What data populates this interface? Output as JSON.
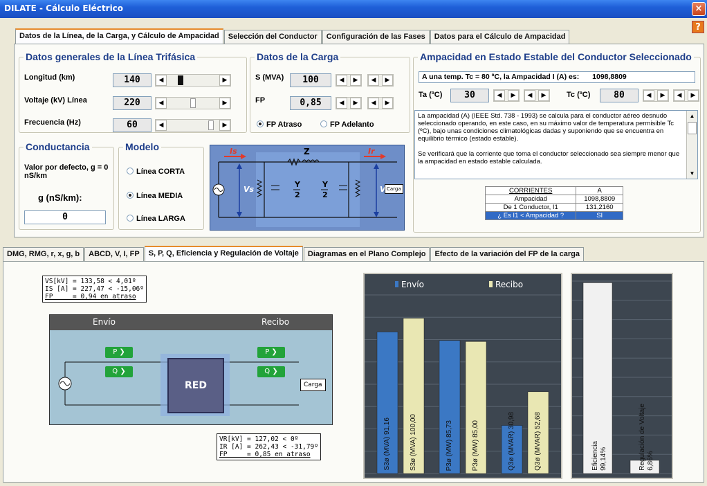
{
  "window": {
    "title": "DILATE - Cálculo Eléctrico",
    "close_glyph": "×",
    "help_glyph": "?"
  },
  "top_tabs": [
    {
      "label": "Datos de la Línea, de la Carga, y Cálculo de Ampacidad",
      "active": true
    },
    {
      "label": "Selección del Conductor",
      "active": false
    },
    {
      "label": "Configuración de las Fases",
      "active": false
    },
    {
      "label": "Datos para el Cálculo de Ampacidad",
      "active": false
    }
  ],
  "linea": {
    "title": "Datos generales de la Línea Trifásica",
    "rows": [
      {
        "label": "Longitud (km)",
        "value": "140"
      },
      {
        "label": "Voltaje (kV) Línea",
        "value": "220"
      },
      {
        "label": "Frecuencia (Hz)",
        "value": "60"
      }
    ]
  },
  "carga": {
    "title": "Datos de la Carga",
    "rows": [
      {
        "label": "S (MVA)",
        "value": "100"
      },
      {
        "label": "FP",
        "value": "0,85"
      }
    ],
    "radio_atraso": "FP Atraso",
    "radio_adelanto": "FP Adelanto",
    "selected": "atraso"
  },
  "ampacidad": {
    "title": "Ampacidad en Estado Estable del Conductor Seleccionado",
    "result_text": "A una temp. Tc = 80 ºC, la Ampacidad I (A) es:",
    "result_value": "1098,8809",
    "ta_label": "Ta (ºC)",
    "ta_value": "30",
    "tc_label": "Tc (ºC)",
    "tc_value": "80",
    "description_1": "La ampacidad (A) (IEEE Std. 738 - 1993) se calcula para el conductor aéreo desnudo seleccionado operando, en este caso, en su máximo valor de temperatura permisible Tc (ºC), bajo unas condiciones climatológicas dadas y suponiendo que se encuentra en equilibrio térmico (estado estable).",
    "description_2": "Se verificará que la corriente que toma el conductor seleccionado sea siempre menor que la ampacidad en estado estable calculada.",
    "table": {
      "headers": [
        "CORRIENTES",
        "A"
      ],
      "rows": [
        [
          "Ampacidad",
          "1098,8809"
        ],
        [
          "De 1 Conductor, I1",
          "131,2160"
        ],
        [
          "¿ Es I1 < Ampacidad ?",
          "SI"
        ]
      ]
    }
  },
  "conductancia": {
    "title": "Conductancia",
    "default_text": "Valor por defecto, g = 0 nS/km",
    "g_label": "g (nS/km):",
    "g_value": "0"
  },
  "modelo": {
    "title": "Modelo",
    "options": [
      "Línea CORTA",
      "Línea MEDIA",
      "Línea LARGA"
    ],
    "selected": 1
  },
  "circuit": {
    "is_label": "Is",
    "ir_label": "Ir",
    "z_label": "Z",
    "vs_label": "Vs",
    "vr_label": "VR",
    "y2_num": "Y",
    "y2_den": "2",
    "carga_label": "Carga"
  },
  "bottom_tabs": [
    {
      "label": "DMG, RMG, r, x, g, b",
      "active": false
    },
    {
      "label": "ABCD, V, I, FP",
      "active": false
    },
    {
      "label": "S, P, Q, Eficiencia y Regulación de Voltaje",
      "active": true
    },
    {
      "label": "Diagramas en el Plano Complejo",
      "active": false
    },
    {
      "label": "Efecto de la variación del FP de la carga",
      "active": false
    }
  ],
  "sending_readout": [
    "VS[kV] = 133,58 < 4,01º",
    "IS [A] = 227,47 < -15,06º",
    "FP     = 0,94 en atraso"
  ],
  "receiving_readout": [
    "VR[kV] = 127,02 < 0º",
    "IR [A] = 262,43 < -31,79º",
    "FP     = 0,85 en atraso"
  ],
  "flow": {
    "envio_label": "Envío",
    "recibo_label": "Recibo",
    "p_label": "P",
    "q_label": "Q",
    "red_label": "RED",
    "carga_label": "Carga"
  },
  "colors": {
    "envio_bar": "#3b78c4",
    "recibo_bar": "#e9e7b3",
    "eff_bar": "#f1f1f1",
    "chart_bg": "#3d4650"
  },
  "chart_data": [
    {
      "type": "bar",
      "legend_position": "top",
      "series": [
        {
          "name": "Envío",
          "color": "#3b78c4"
        },
        {
          "name": "Recibo",
          "color": "#e9e7b3"
        }
      ],
      "bars": [
        {
          "label": "S3ø (MVA) 91,16",
          "value": 91.16,
          "series": "Envío"
        },
        {
          "label": "S3ø (MVA) 100,00",
          "value": 100.0,
          "series": "Recibo"
        },
        {
          "label": "P3ø (MW) 85,73",
          "value": 85.73,
          "series": "Envío"
        },
        {
          "label": "P3ø (MW) 85,00",
          "value": 85.0,
          "series": "Recibo"
        },
        {
          "label": "Q3ø (MVAR) 30,98",
          "value": 30.98,
          "series": "Envío"
        },
        {
          "label": "Q3ø (MVAR) 52,68",
          "value": 52.68,
          "series": "Recibo"
        }
      ],
      "ylim": [
        0,
        115
      ],
      "grid": true
    },
    {
      "type": "bar",
      "bars": [
        {
          "label_1": "Eficiencia",
          "label_2": "99,14%",
          "value": 99.14
        },
        {
          "label_1": "Regulación de Voltaje",
          "label_2": "6,86%",
          "value": 6.86
        }
      ],
      "ylim": [
        0,
        100
      ],
      "grid": true
    }
  ]
}
